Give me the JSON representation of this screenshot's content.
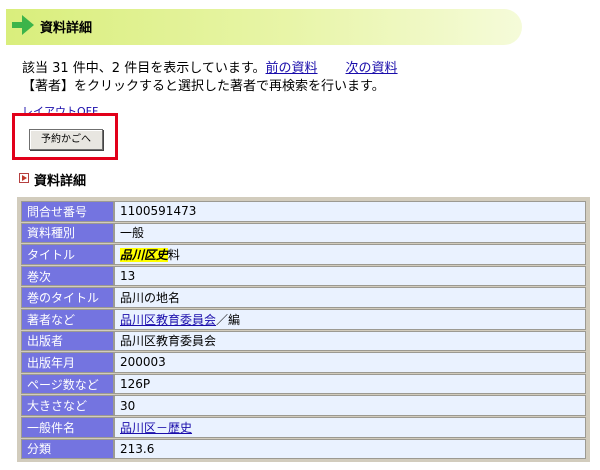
{
  "header": {
    "title": "資料詳細",
    "arrow_icon": "arrow-right-icon",
    "accent": "#3cb44a"
  },
  "info": {
    "line1_prefix": "該当 31 件中、2 件目を表示しています。",
    "prev_link": "前の資料",
    "next_link": "次の資料",
    "line2": "【著者】をクリックすると選択した著者で再検索を行います。"
  },
  "cut_link": "レイアウトOFF",
  "reserve_button": "予約かごへ",
  "section_title": "資料詳細",
  "details": [
    {
      "label": "問合せ番号",
      "value": "1100591473"
    },
    {
      "label": "資料種別",
      "value": "一般"
    },
    {
      "label": "タイトル",
      "value_highlight": "品川区史",
      "value_rest": "料"
    },
    {
      "label": "巻次",
      "value": "13"
    },
    {
      "label": "巻のタイトル",
      "value": "品川の地名"
    },
    {
      "label": "著者など",
      "value_link": "品川区教育委員会",
      "value_rest": "／編"
    },
    {
      "label": "出版者",
      "value": "品川区教育委員会"
    },
    {
      "label": "出版年月",
      "value": "200003"
    },
    {
      "label": "ページ数など",
      "value": "126P"
    },
    {
      "label": "大きさなど",
      "value": "30"
    },
    {
      "label": "一般件名",
      "value_link": "品川区－歴史"
    },
    {
      "label": "分類",
      "value": "213.6"
    }
  ],
  "colors": {
    "label_bg": "#7474e0",
    "value_bg": "#eaf2ff",
    "highlight": "#ffff00",
    "frame": "#e2001a"
  }
}
